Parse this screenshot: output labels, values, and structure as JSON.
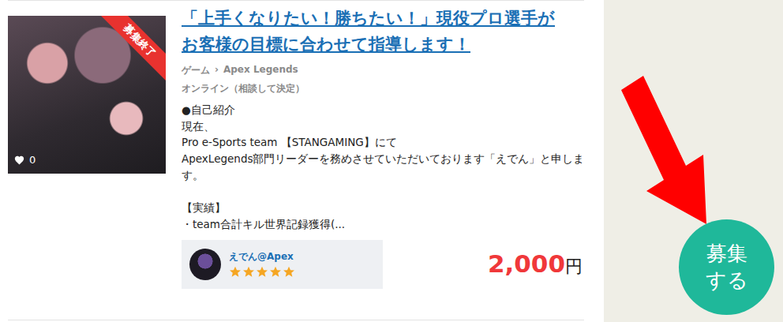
{
  "listing": {
    "thumbnail": {
      "ribbon": "募集終了",
      "likes": "0"
    },
    "title": [
      "「上手くなりたい！勝ちたい！」現役プロ選手が",
      "お客様の目標に合わせて指導します！"
    ],
    "breadcrumb": {
      "category": "ゲーム",
      "separator": "›",
      "subcategory": "Apex Legends"
    },
    "format": "オンライン（相談して決定）",
    "description": [
      "●自己紹介",
      "現在、",
      "Pro e-Sports team 【STANGAMING】にて",
      "ApexLegends部門リーダーを務めさせていただいております「えでん」と申しま",
      "す。",
      "",
      "【実績】",
      "・team合計キル世界記録獲得(..."
    ],
    "seller": {
      "name": "えでん@Apex",
      "stars": 5
    },
    "price": {
      "amount": "2,000",
      "unit": "円"
    }
  },
  "cta": {
    "label": "募集する"
  }
}
